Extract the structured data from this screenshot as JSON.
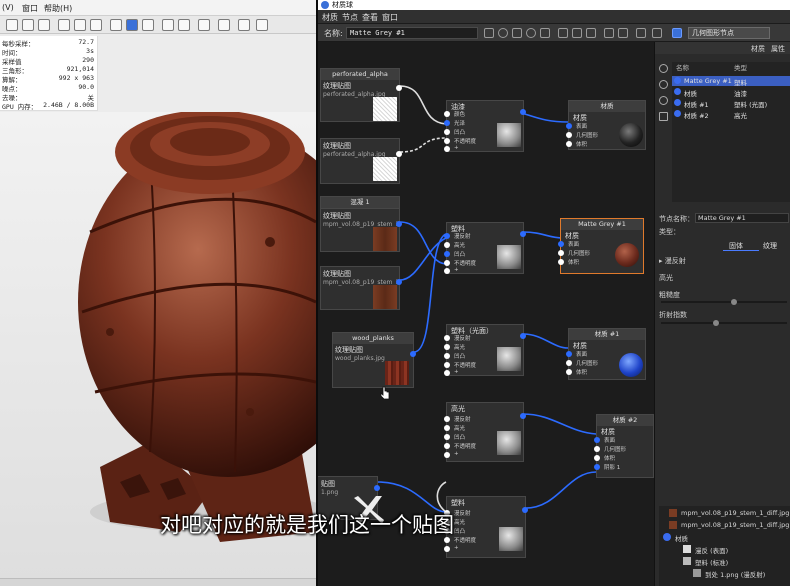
{
  "viewer": {
    "menu": [
      "(V)",
      "窗口",
      "帮助(H)"
    ],
    "stats": [
      {
        "k": "每秒采样：",
        "v": "72.7"
      },
      {
        "k": "时间：",
        "v": "3s"
      },
      {
        "k": "采样值",
        "v": "290"
      },
      {
        "k": "三角形：",
        "v": "921,014"
      },
      {
        "k": "算解：",
        "v": "992 x 963"
      },
      {
        "k": "噪点：",
        "v": "90.0"
      },
      {
        "k": "去噪：",
        "v": "关"
      },
      {
        "k": "GPU 内存：",
        "v": "2.46B / 8.00B"
      }
    ]
  },
  "editor": {
    "title": "材质球",
    "menu": [
      "材质",
      "节点",
      "查看",
      "窗口"
    ],
    "toolbar": {
      "name_label": "名称:",
      "name_value": "Matte Grey #1",
      "geometry_button": "几何图形节点"
    }
  },
  "graph": {
    "nodes": {
      "tex_alpha_top": {
        "header": "perforated_alpha",
        "title": "纹理贴图",
        "file": "perforated_alpha.jpg"
      },
      "tex_alpha_2": {
        "title": "纹理贴图",
        "file": "perforated_alpha.jpg"
      },
      "mix_node": {
        "header": "混凝 1"
      },
      "tex_stem_1": {
        "title": "纹理贴图",
        "file": "mpm_vol.08_p19_stem_1_diff.jpg"
      },
      "tex_stem_2": {
        "title": "纹理贴图",
        "file": "mpm_vol.08_p19_stem_1_diff.jpg"
      },
      "tex_planks": {
        "header": "wood_planks",
        "title": "纹理贴图",
        "file": "wood_planks.jpg"
      },
      "oil_shader": {
        "title": "油漆",
        "ports": [
          "颜色",
          "光泽",
          "凹凸",
          "不透明度",
          "+"
        ]
      },
      "out_top": {
        "header": "材质",
        "title": "材质",
        "ports": [
          "表面",
          "几何图形",
          "体积"
        ]
      },
      "plastic_shader": {
        "title": "塑料",
        "ports": [
          "漫反射",
          "高光",
          "凹凸",
          "不透明度",
          "+"
        ]
      },
      "matte_grey": {
        "header": "Matte Grey #1",
        "title": "材质",
        "ports": [
          "表面",
          "几何图形",
          "体积"
        ]
      },
      "plastic_gloss": {
        "title": "塑料（光面）",
        "ports": [
          "漫反射",
          "高光",
          "凹凸",
          "不透明度",
          "+"
        ]
      },
      "out_mid": {
        "header": "材质 #1",
        "title": "材质",
        "ports": [
          "表面",
          "几何图形",
          "体积"
        ]
      },
      "gloss_shader": {
        "title": "高光",
        "ports": [
          "漫反射",
          "高光",
          "凹凸",
          "不透明度",
          "+"
        ]
      },
      "out_bottom": {
        "header": "材质 #2",
        "title": "材质",
        "ports": [
          "表面",
          "几何图形",
          "体积",
          "阴影 1"
        ]
      },
      "plastic_bottom": {
        "title": "塑料",
        "ports": [
          "漫反射",
          "高光",
          "凹凸",
          "不透明度",
          "+"
        ]
      },
      "tex_bottom": {
        "title": "贴图",
        "file": "1.png"
      }
    }
  },
  "props": {
    "tabs": [
      "材质",
      "属性"
    ],
    "table_header": [
      "名称",
      "类型"
    ],
    "materials": [
      {
        "name": "Matte Grey #1",
        "type": "塑料",
        "selected": true
      },
      {
        "name": "材质",
        "type": "油漆",
        "selected": false
      },
      {
        "name": "材质 #1",
        "type": "塑料 (光面)",
        "selected": false
      },
      {
        "name": "材质 #2",
        "type": "高光",
        "selected": false
      }
    ],
    "node_name_label": "节点名称：",
    "node_name_value": "Matte Grey #1",
    "type_label": "类型：",
    "type_tabs": [
      "固体",
      "纹理"
    ],
    "sections": [
      "▸ 漫反射",
      "高光",
      "粗糙度",
      "折射指数"
    ],
    "textures": [
      {
        "label": "mpm_vol.08_p19_stem_1_diff.jpg",
        "swatch": "#7a3c23"
      },
      {
        "label": "mpm_vol.08_p19_stem_1_diff.jpg",
        "swatch": "#7a3c23"
      },
      {
        "label": "材质",
        "swatch": "#3a6cf0"
      },
      {
        "label": "漫反 (表面)",
        "swatch": "#dddddd"
      },
      {
        "label": "塑料 (标准)",
        "swatch": "#bbbbbb"
      },
      {
        "label": "到处 1.png (漫反射)",
        "swatch": "#999999"
      }
    ]
  },
  "subtitle": "对吧对应的就是我们这一个贴图"
}
